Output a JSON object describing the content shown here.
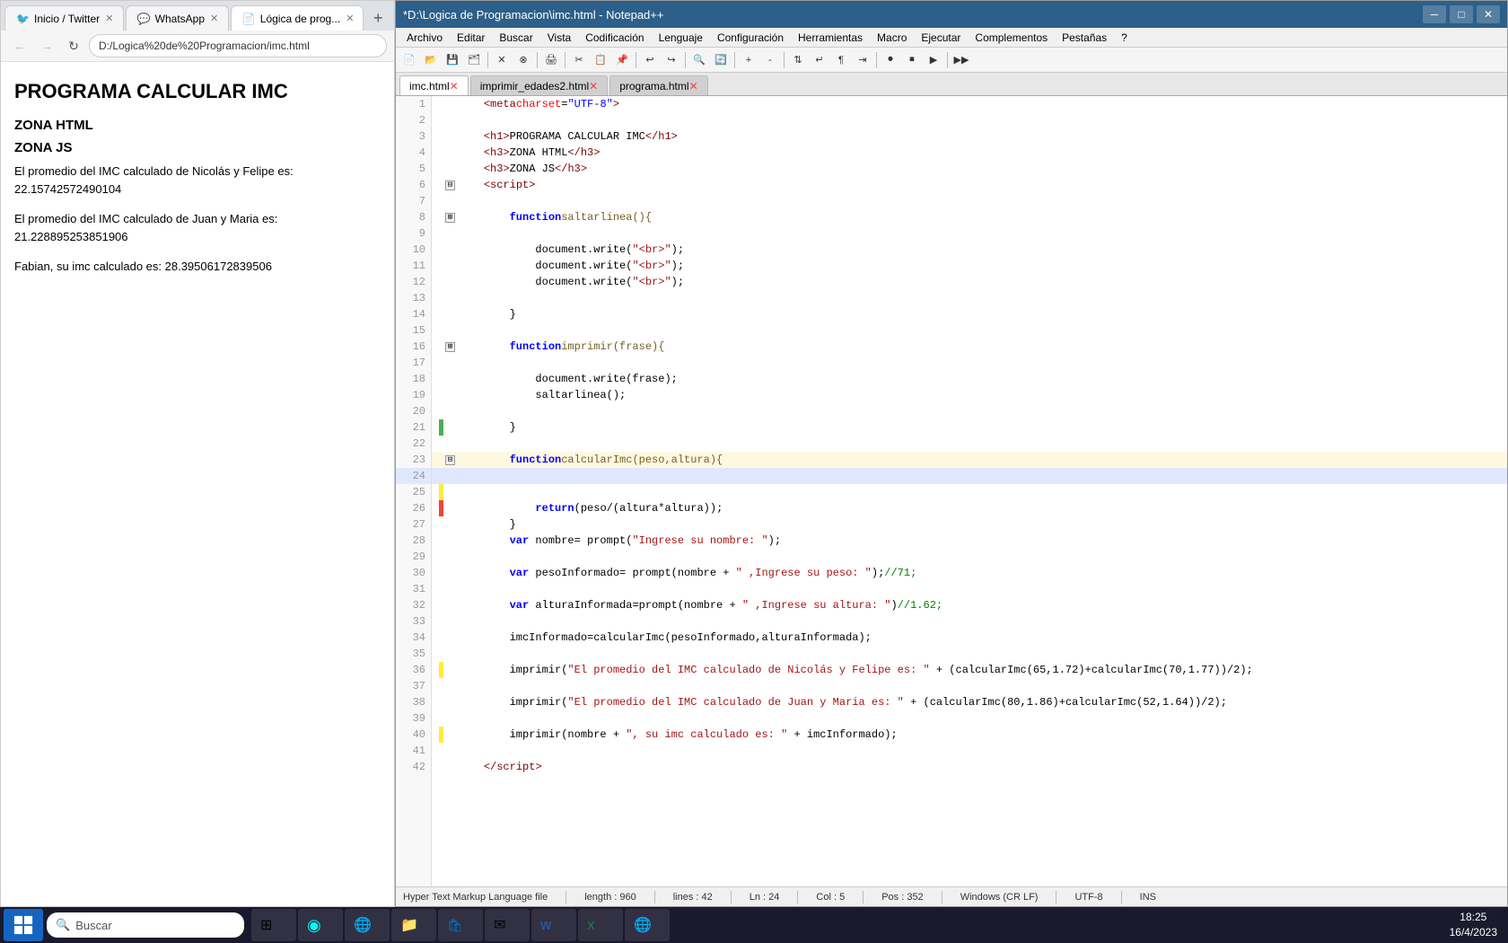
{
  "browser": {
    "tabs": [
      {
        "id": "twitter",
        "label": "Inicio / Twitter",
        "active": false,
        "icon": "🐦"
      },
      {
        "id": "whatsapp",
        "label": "WhatsApp",
        "active": false,
        "icon": "💬"
      },
      {
        "id": "logica",
        "label": "Lógica de prog...",
        "active": true,
        "icon": "📄"
      }
    ],
    "address": "D:/Logica%20de%20Programacion/imc.html",
    "title": "PROGRAMA CALCULAR IMC",
    "zone_html": "ZONA HTML",
    "zone_js": "ZONA JS",
    "line1": "El promedio del IMC calculado de Nicolás y Felipe es: 22.15742572490104",
    "line2": "El promedio del IMC calculado de Juan y Maria es: 21.228895253851906",
    "line3": "Fabian, su imc calculado es: 28.39506172839506"
  },
  "notepad": {
    "title": "*D:\\Logica de Programacion\\imc.html - Notepad++",
    "menus": [
      "Archivo",
      "Editar",
      "Buscar",
      "Vista",
      "Codificación",
      "Lenguaje",
      "Configuración",
      "Herramientas",
      "Macro",
      "Ejecutar",
      "Complementos",
      "Pestañas",
      "?"
    ],
    "tabs": [
      {
        "label": "imc.html",
        "active": true,
        "modified": true
      },
      {
        "label": "imprimir_edades2.html",
        "active": false,
        "modified": true
      },
      {
        "label": "programa.html",
        "active": false,
        "modified": true
      }
    ],
    "statusbar": {
      "file_type": "Hyper Text Markup Language file",
      "length": "length : 960",
      "lines": "lines : 42",
      "ln": "Ln : 24",
      "col": "Col : 5",
      "pos": "Pos : 352",
      "line_endings": "Windows (CR LF)",
      "encoding": "UTF-8",
      "ins": "INS"
    }
  },
  "taskbar": {
    "search_placeholder": "Buscar",
    "clock_time": "18:25",
    "clock_date": "16/4/2023",
    "apps": [
      "twitter-icon",
      "whatsapp-icon",
      "edge-icon",
      "notepad-icon"
    ]
  }
}
